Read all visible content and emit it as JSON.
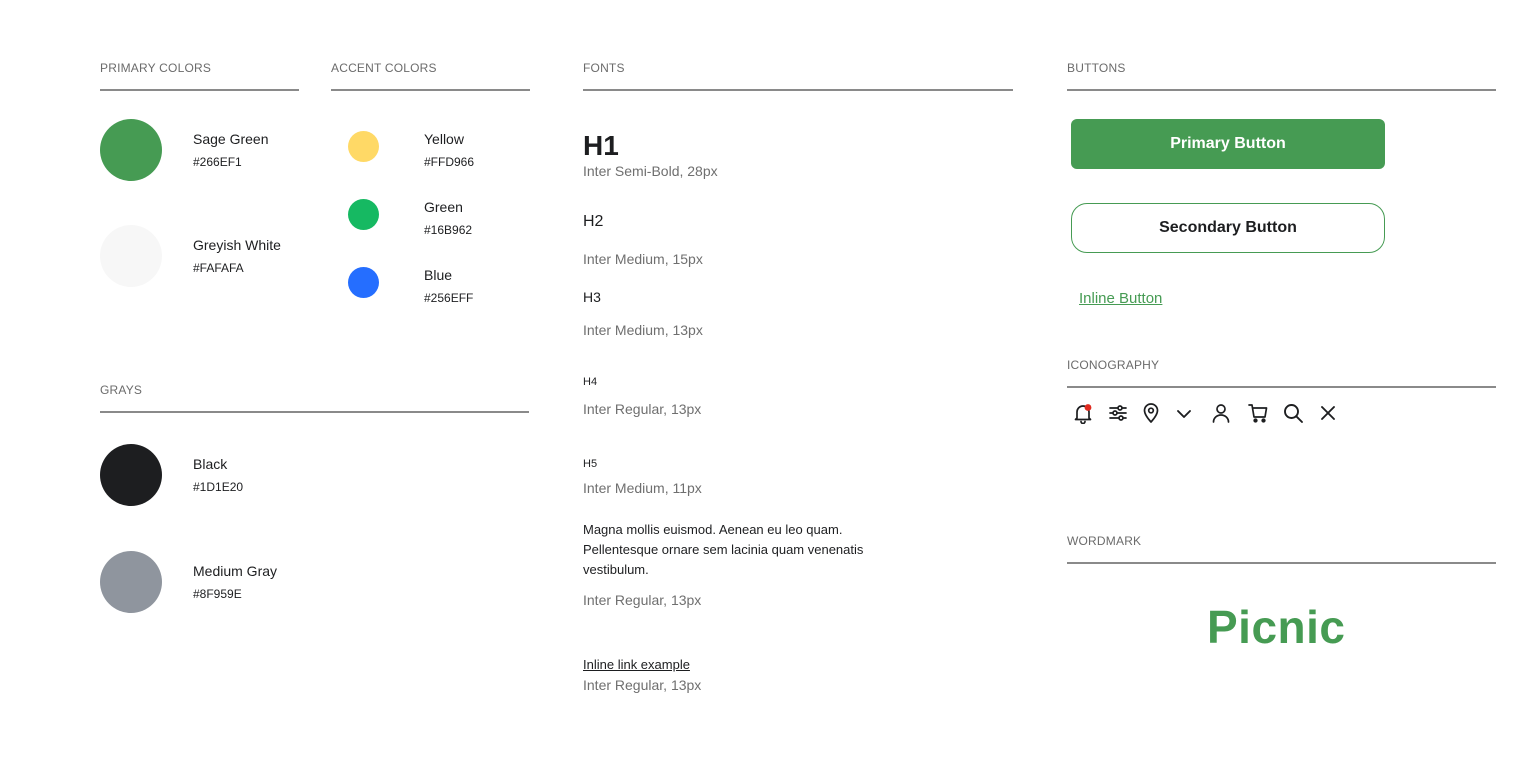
{
  "sections": {
    "primary_colors": "PRIMARY COLORS",
    "accent_colors": "ACCENT COLORS",
    "fonts": "FONTS",
    "buttons": "BUTTONS",
    "grays": "GRAYS",
    "iconography": "ICONOGRAPHY",
    "wordmark": "WORDMARK"
  },
  "primary_colors": [
    {
      "name": "Sage Green",
      "hex": "#266EF1",
      "swatch": "#469B53"
    },
    {
      "name": "Greyish White",
      "hex": "#FAFAFA",
      "swatch": "#F7F7F7"
    }
  ],
  "accent_colors": [
    {
      "name": "Yellow",
      "hex": "#FFD966",
      "swatch": "#FFD966"
    },
    {
      "name": "Green",
      "hex": "#16B962",
      "swatch": "#16B962"
    },
    {
      "name": "Blue",
      "hex": "#256EFF",
      "swatch": "#256EFF"
    }
  ],
  "grays": [
    {
      "name": "Black",
      "hex": "#1D1E20",
      "swatch": "#1D1E20"
    },
    {
      "name": "Medium Gray",
      "hex": "#8F959E",
      "swatch": "#8F959E"
    }
  ],
  "fonts": {
    "h1": {
      "label": "H1",
      "desc": "Inter Semi-Bold, 28px"
    },
    "h2": {
      "label": "H2",
      "desc": "Inter Medium, 15px"
    },
    "h3": {
      "label": "H3",
      "desc": "Inter Medium, 13px"
    },
    "h4": {
      "label": "H4",
      "desc": "Inter Regular, 13px"
    },
    "h5": {
      "label": "H5",
      "desc": "Inter Medium, 11px"
    },
    "body": {
      "text": "Magna mollis euismod. Aenean eu leo quam. Pellentesque ornare sem lacinia quam venenatis vestibulum.",
      "desc": "Inter Regular, 13px"
    },
    "link": {
      "text": "Inline link example",
      "desc": "Inter Regular, 13px"
    }
  },
  "buttons": {
    "primary": "Primary Button",
    "secondary": "Secondary Button",
    "inline": "Inline Button"
  },
  "icons": [
    "bell-icon",
    "sliders-icon",
    "location-pin-icon",
    "chevron-down-icon",
    "user-icon",
    "cart-icon",
    "search-icon",
    "close-icon"
  ],
  "colors": {
    "brand_green": "#469B53",
    "notification_dot": "#E02B20"
  },
  "wordmark": "Picnic"
}
